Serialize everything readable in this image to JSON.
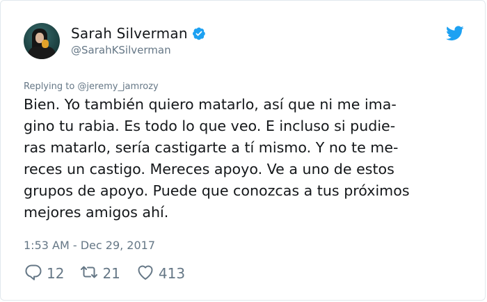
{
  "author": {
    "display_name": "Sarah Silverman",
    "handle": "@SarahKSilverman",
    "verified": true
  },
  "reply_context": "Replying to @jeremy_jamrozy",
  "tweet": {
    "text": "Bien. Yo también quiero matarlo, así que ni me ima-\ngino tu rabia. Es todo lo que veo. E incluso si pudie-\nras matarlo, sería castigarte a tí mismo. Y no te me-\nreces un castigo. Mereces apoyo. Ve a uno de estos\ngrupos de apoyo. Puede que conozcas a tus próximos\nmejores amigos ahí.",
    "timestamp": "1:53 AM - Dec 29, 2017"
  },
  "actions": {
    "replies": "12",
    "retweets": "21",
    "likes": "413"
  },
  "icons": {
    "brand": "twitter-bird-icon",
    "verified": "verified-badge-icon",
    "reply": "reply-icon",
    "retweet": "retweet-icon",
    "like": "heart-icon"
  },
  "colors": {
    "twitter_blue": "#1da1f2",
    "text": "#14171a",
    "secondary_text": "#657786",
    "border": "#e1e8ed"
  }
}
